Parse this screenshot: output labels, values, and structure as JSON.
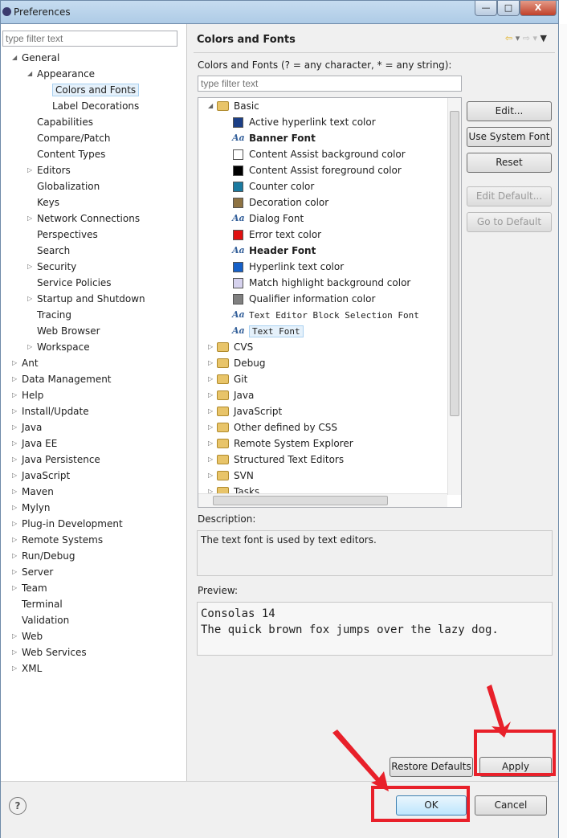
{
  "window": {
    "title": "Preferences",
    "minimize": "—",
    "maximize": "□",
    "close": "X"
  },
  "left": {
    "filter_placeholder": "type filter text",
    "tree": [
      {
        "label": "General",
        "level": 0,
        "expanded": true
      },
      {
        "label": "Appearance",
        "level": 1,
        "expanded": true
      },
      {
        "label": "Colors and Fonts",
        "level": 2,
        "selected": true
      },
      {
        "label": "Label Decorations",
        "level": 2
      },
      {
        "label": "Capabilities",
        "level": 1
      },
      {
        "label": "Compare/Patch",
        "level": 1
      },
      {
        "label": "Content Types",
        "level": 1
      },
      {
        "label": "Editors",
        "level": 1,
        "expandable": true
      },
      {
        "label": "Globalization",
        "level": 1
      },
      {
        "label": "Keys",
        "level": 1
      },
      {
        "label": "Network Connections",
        "level": 1,
        "expandable": true
      },
      {
        "label": "Perspectives",
        "level": 1
      },
      {
        "label": "Search",
        "level": 1
      },
      {
        "label": "Security",
        "level": 1,
        "expandable": true
      },
      {
        "label": "Service Policies",
        "level": 1
      },
      {
        "label": "Startup and Shutdown",
        "level": 1,
        "expandable": true
      },
      {
        "label": "Tracing",
        "level": 1
      },
      {
        "label": "Web Browser",
        "level": 1
      },
      {
        "label": "Workspace",
        "level": 1,
        "expandable": true
      },
      {
        "label": "Ant",
        "level": 0,
        "expandable": true
      },
      {
        "label": "Data Management",
        "level": 0,
        "expandable": true
      },
      {
        "label": "Help",
        "level": 0,
        "expandable": true
      },
      {
        "label": "Install/Update",
        "level": 0,
        "expandable": true
      },
      {
        "label": "Java",
        "level": 0,
        "expandable": true
      },
      {
        "label": "Java EE",
        "level": 0,
        "expandable": true
      },
      {
        "label": "Java Persistence",
        "level": 0,
        "expandable": true
      },
      {
        "label": "JavaScript",
        "level": 0,
        "expandable": true
      },
      {
        "label": "Maven",
        "level": 0,
        "expandable": true
      },
      {
        "label": "Mylyn",
        "level": 0,
        "expandable": true
      },
      {
        "label": "Plug-in Development",
        "level": 0,
        "expandable": true
      },
      {
        "label": "Remote Systems",
        "level": 0,
        "expandable": true
      },
      {
        "label": "Run/Debug",
        "level": 0,
        "expandable": true
      },
      {
        "label": "Server",
        "level": 0,
        "expandable": true
      },
      {
        "label": "Team",
        "level": 0,
        "expandable": true
      },
      {
        "label": "Terminal",
        "level": 0
      },
      {
        "label": "Validation",
        "level": 0
      },
      {
        "label": "Web",
        "level": 0,
        "expandable": true
      },
      {
        "label": "Web Services",
        "level": 0,
        "expandable": true
      },
      {
        "label": "XML",
        "level": 0,
        "expandable": true
      }
    ]
  },
  "main": {
    "title": "Colors and Fonts",
    "filter_label": "Colors and Fonts (? = any character, * = any string):",
    "filter_placeholder": "type filter text",
    "tree": [
      {
        "label": "Basic",
        "kind": "category",
        "expanded": true
      },
      {
        "label": "Active hyperlink text color",
        "kind": "color",
        "color": "#1c3f86"
      },
      {
        "label": "Banner Font",
        "kind": "font",
        "bold": true
      },
      {
        "label": "Content Assist background color",
        "kind": "color",
        "color": "#ffffff"
      },
      {
        "label": "Content Assist foreground color",
        "kind": "color",
        "color": "#000000"
      },
      {
        "label": "Counter color",
        "kind": "color",
        "color": "#1b7aa0"
      },
      {
        "label": "Decoration color",
        "kind": "color",
        "color": "#8e7343"
      },
      {
        "label": "Dialog Font",
        "kind": "font"
      },
      {
        "label": "Error text color",
        "kind": "color",
        "color": "#e01010"
      },
      {
        "label": "Header Font",
        "kind": "font",
        "bold": true
      },
      {
        "label": "Hyperlink text color",
        "kind": "color",
        "color": "#1560c8"
      },
      {
        "label": "Match highlight background color",
        "kind": "color",
        "color": "#d6d2ee"
      },
      {
        "label": "Qualifier information color",
        "kind": "color",
        "color": "#808080"
      },
      {
        "label": "Text Editor Block Selection Font",
        "kind": "font",
        "mono": true
      },
      {
        "label": "Text Font",
        "kind": "font",
        "mono": true,
        "selected": true
      },
      {
        "label": "CVS",
        "kind": "category"
      },
      {
        "label": "Debug",
        "kind": "category"
      },
      {
        "label": "Git",
        "kind": "category"
      },
      {
        "label": "Java",
        "kind": "category"
      },
      {
        "label": "JavaScript",
        "kind": "category"
      },
      {
        "label": "Other defined by CSS",
        "kind": "category"
      },
      {
        "label": "Remote System Explorer",
        "kind": "category"
      },
      {
        "label": "Structured Text Editors",
        "kind": "category"
      },
      {
        "label": "SVN",
        "kind": "category"
      },
      {
        "label": "Tasks",
        "kind": "category"
      }
    ],
    "buttons": {
      "edit": "Edit...",
      "use_system_font": "Use System Font",
      "reset": "Reset",
      "edit_default": "Edit Default...",
      "go_to_default": "Go to Default"
    },
    "description_label": "Description:",
    "description": "The text font is used by text editors.",
    "preview_label": "Preview:",
    "preview_line1": "Consolas 14",
    "preview_line2": "The quick brown fox jumps over the lazy dog.",
    "restore_defaults": "Restore Defaults",
    "apply": "Apply"
  },
  "footer": {
    "ok": "OK",
    "cancel": "Cancel",
    "help": "?"
  },
  "annotation_color": "#e8202a"
}
